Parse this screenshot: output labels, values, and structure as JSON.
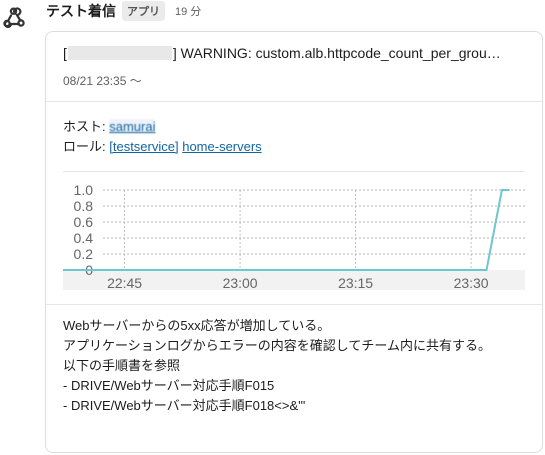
{
  "app": {
    "sender": "テスト着信",
    "badge": "アプリ",
    "time": "19 分",
    "icon": "webhook-icon"
  },
  "alert": {
    "title_prefix": "[",
    "title_suffix": "] WARNING: custom.alb.httpcode_count_per_grou…",
    "date": "08/21 23:35 ～",
    "host_label": "ホスト: ",
    "host_value": "samurai",
    "role_label": "ロール: ",
    "role_link": "[testservice]",
    "role_link2": "home-servers"
  },
  "chart_data": {
    "type": "line",
    "title": "",
    "xlabel": "",
    "ylabel": "",
    "y_ticks": [
      "1.0",
      "0.8",
      "0.6",
      "0.4",
      "0.2",
      "0"
    ],
    "x_ticks": [
      "22:45",
      "23:00",
      "23:15",
      "23:30"
    ],
    "ylim": [
      0,
      1
    ],
    "grid": true,
    "series": [
      {
        "color": "#6ec7cd",
        "x": [
          "22:37",
          "23:32",
          "23:34",
          "23:35"
        ],
        "values": [
          0,
          0,
          1,
          1
        ]
      }
    ]
  },
  "message": {
    "line1": "Webサーバーからの5xx応答が増加している。",
    "line2": "アプリケーションログからエラーの内容を確認してチーム内に共有する。",
    "line3": "以下の手順書を参照",
    "line4": "- DRIVE/Webサーバー対応手順F015",
    "line5": "- DRIVE/Webサーバー対応手順F018<>&'\""
  }
}
